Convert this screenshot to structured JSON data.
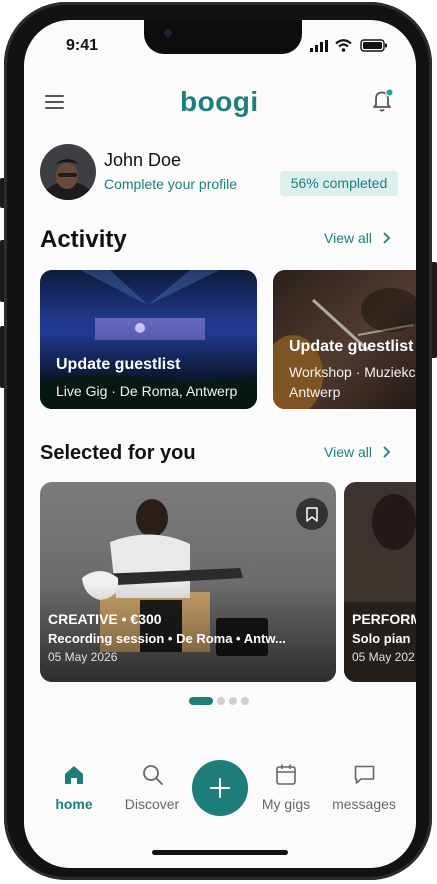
{
  "status_bar": {
    "time": "9:41"
  },
  "header": {
    "logo_text": "boogi",
    "menu_icon": "menu-icon",
    "bell_icon": "bell-icon"
  },
  "profile": {
    "name": "John Doe",
    "subtitle": "Complete your profile",
    "completion_badge": "56% completed"
  },
  "activity": {
    "title": "Activity",
    "view_all": "View all",
    "cards": [
      {
        "title": "Update guestlist",
        "subtitle": "Live Gig · De Roma, Antwerp"
      },
      {
        "title": "Update guestlist",
        "subtitle_line1": "Workshop · Muziekc",
        "subtitle_line2": "Antwerp"
      }
    ]
  },
  "selected": {
    "title": "Selected for you",
    "view_all": "View all",
    "cards": [
      {
        "category": "CREATIVE • €300",
        "title": "Recording session • De Roma • Antw...",
        "date": "05 May 2026"
      },
      {
        "category": "PERFORM",
        "title": "Solo pian",
        "date": "05 May 202"
      }
    ],
    "carousel_position": 1,
    "carousel_total": 4
  },
  "bottom_nav": {
    "items": [
      {
        "label": "home",
        "icon": "home-icon",
        "active": true
      },
      {
        "label": "Discover",
        "icon": "search-icon",
        "active": false
      },
      {
        "label": "My gigs",
        "icon": "calendar-icon",
        "active": false
      },
      {
        "label": "messages",
        "icon": "message-icon",
        "active": false
      }
    ],
    "fab_icon": "plus-icon"
  },
  "colors": {
    "accent": "#1e7f7a",
    "badge_bg": "#dcefed",
    "notification_dot": "#2a9d8f"
  }
}
